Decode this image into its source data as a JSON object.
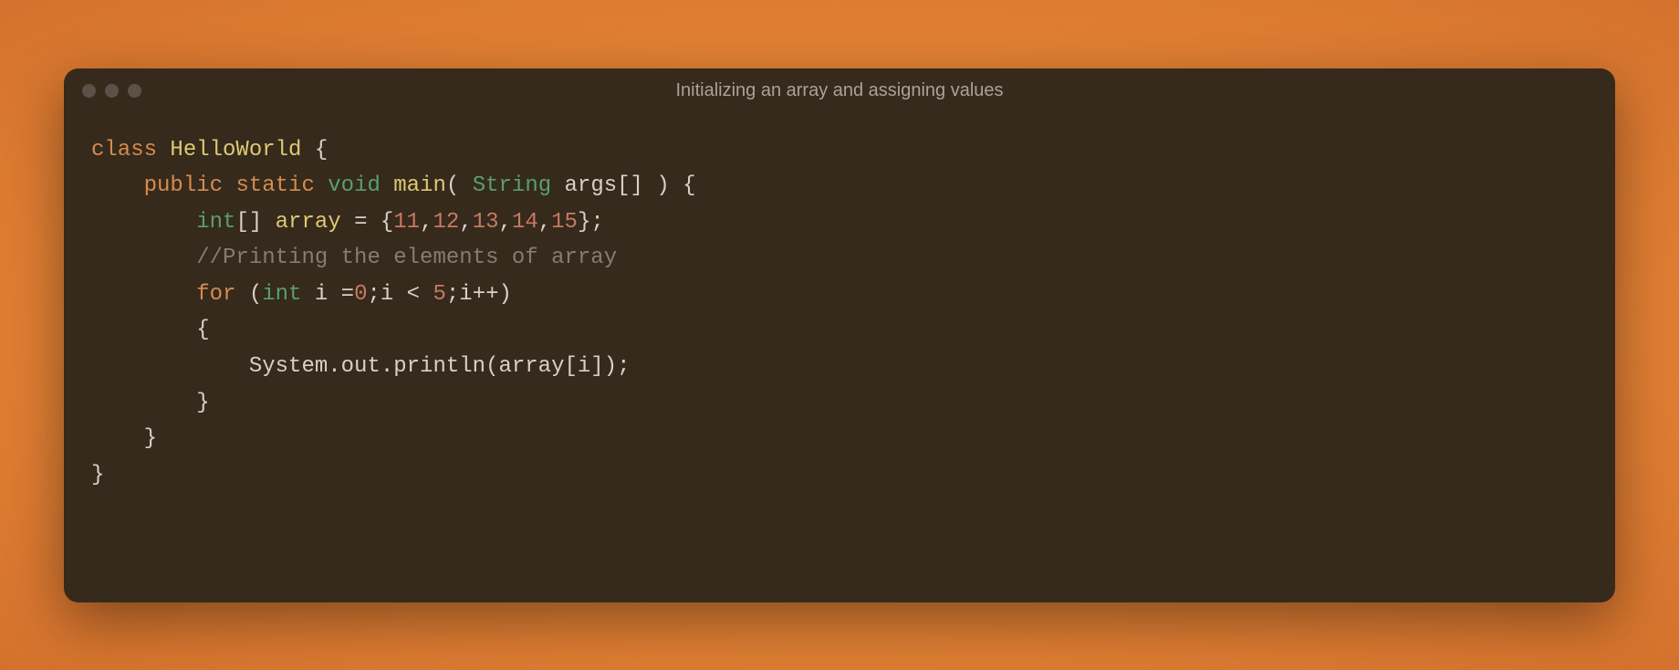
{
  "window": {
    "title": "Initializing an array and assigning values"
  },
  "code": {
    "lines": [
      {
        "indent": 0,
        "tokens": [
          {
            "t": "class ",
            "c": "tok-keyword"
          },
          {
            "t": "HelloWorld",
            "c": "tok-method"
          },
          {
            "t": " {",
            "c": "tok-punct"
          }
        ]
      },
      {
        "indent": 1,
        "tokens": [
          {
            "t": "public ",
            "c": "tok-keyword"
          },
          {
            "t": "static ",
            "c": "tok-keyword"
          },
          {
            "t": "void ",
            "c": "tok-type"
          },
          {
            "t": "main",
            "c": "tok-method"
          },
          {
            "t": "( ",
            "c": "tok-punct"
          },
          {
            "t": "String",
            "c": "tok-type"
          },
          {
            "t": " args[] ) {",
            "c": "tok-punct"
          }
        ]
      },
      {
        "indent": 2,
        "tokens": [
          {
            "t": "int",
            "c": "tok-type"
          },
          {
            "t": "[] ",
            "c": "tok-punct"
          },
          {
            "t": "array",
            "c": "tok-method"
          },
          {
            "t": " = {",
            "c": "tok-punct"
          },
          {
            "t": "11",
            "c": "tok-number"
          },
          {
            "t": ",",
            "c": "tok-punct"
          },
          {
            "t": "12",
            "c": "tok-number"
          },
          {
            "t": ",",
            "c": "tok-punct"
          },
          {
            "t": "13",
            "c": "tok-number"
          },
          {
            "t": ",",
            "c": "tok-punct"
          },
          {
            "t": "14",
            "c": "tok-number"
          },
          {
            "t": ",",
            "c": "tok-punct"
          },
          {
            "t": "15",
            "c": "tok-number"
          },
          {
            "t": "};",
            "c": "tok-punct"
          }
        ]
      },
      {
        "indent": 2,
        "tokens": [
          {
            "t": "//Printing the elements of array",
            "c": "tok-comment"
          }
        ]
      },
      {
        "indent": 2,
        "tokens": [
          {
            "t": "for ",
            "c": "tok-keyword"
          },
          {
            "t": "(",
            "c": "tok-punct"
          },
          {
            "t": "int",
            "c": "tok-type"
          },
          {
            "t": " i =",
            "c": "tok-punct"
          },
          {
            "t": "0",
            "c": "tok-number"
          },
          {
            "t": ";i < ",
            "c": "tok-punct"
          },
          {
            "t": "5",
            "c": "tok-number"
          },
          {
            "t": ";i++)",
            "c": "tok-punct"
          }
        ]
      },
      {
        "indent": 2,
        "tokens": [
          {
            "t": "{",
            "c": "tok-punct"
          }
        ]
      },
      {
        "indent": 3,
        "tokens": [
          {
            "t": "System.out.println(array[i]);",
            "c": "tok-var"
          }
        ]
      },
      {
        "indent": 2,
        "tokens": [
          {
            "t": "}",
            "c": "tok-punct"
          }
        ]
      },
      {
        "indent": 1,
        "tokens": [
          {
            "t": "}",
            "c": "tok-punct"
          }
        ]
      },
      {
        "indent": 0,
        "tokens": [
          {
            "t": "}",
            "c": "tok-punct"
          }
        ]
      }
    ],
    "indent_unit": "    "
  }
}
